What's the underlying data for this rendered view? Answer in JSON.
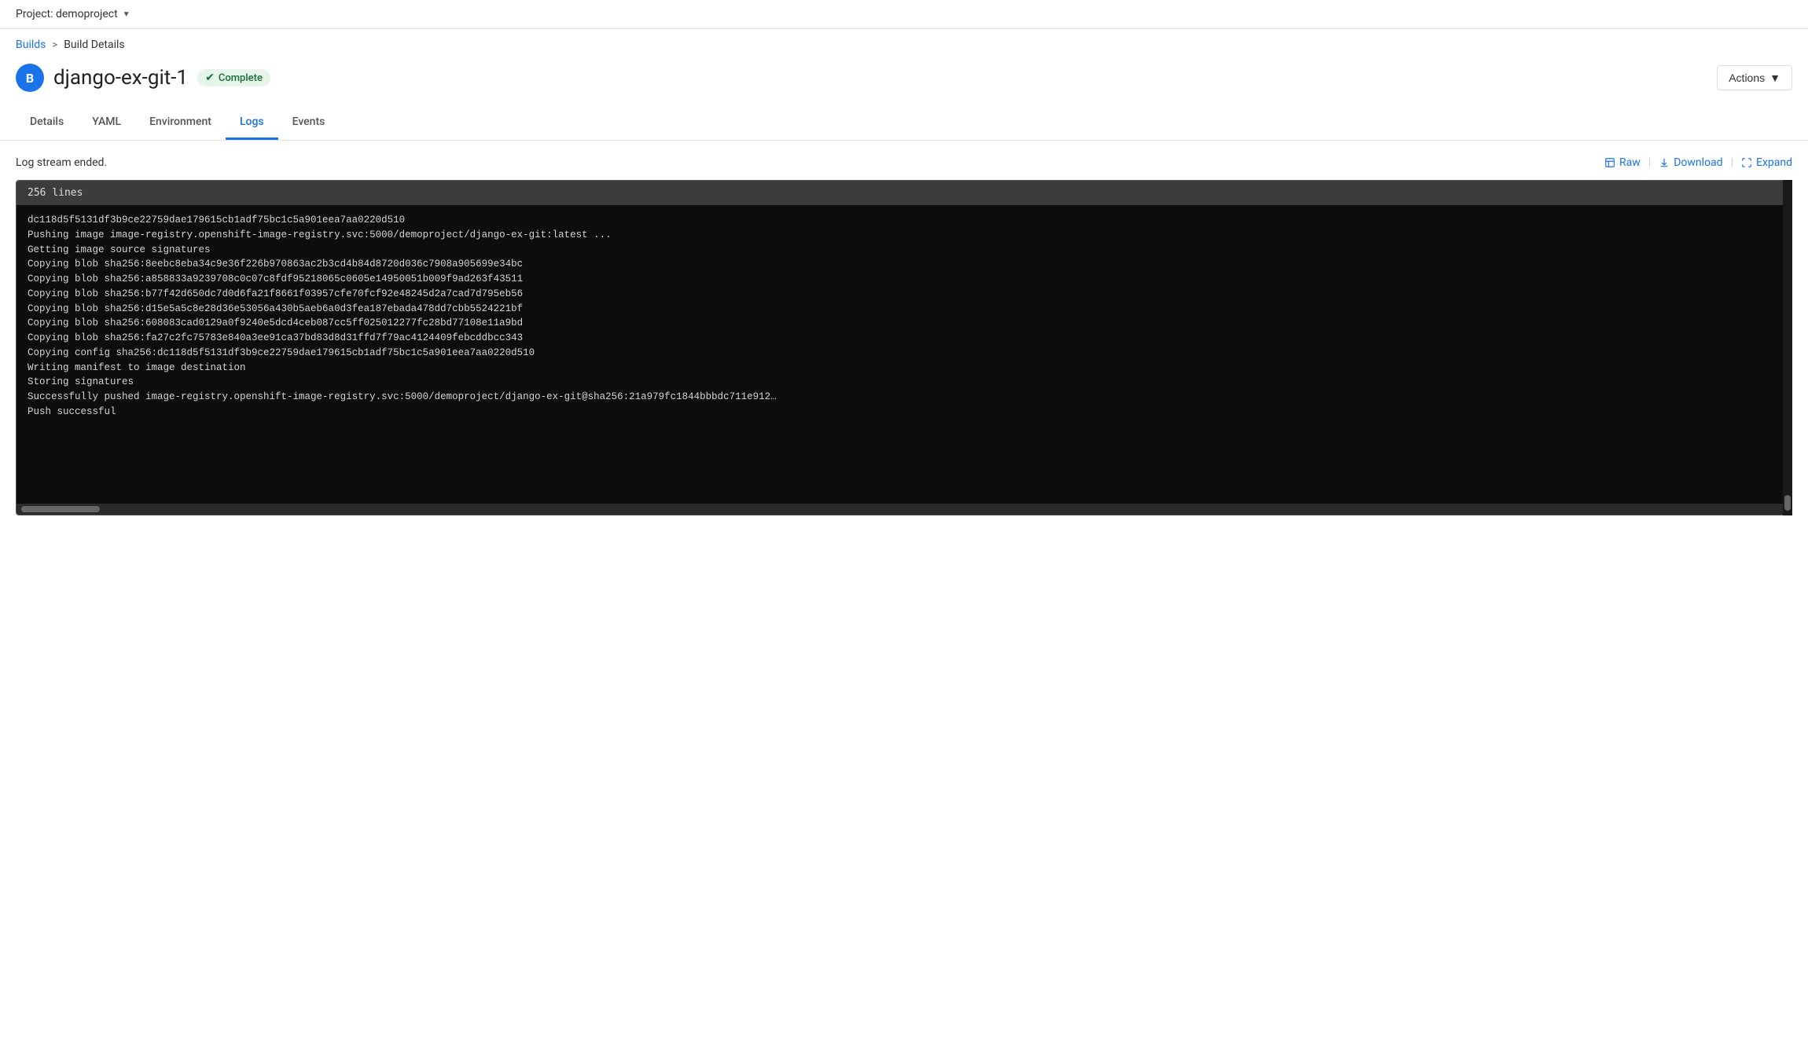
{
  "topbar": {
    "project_label": "Project: demoproject",
    "chevron": "▼"
  },
  "breadcrumb": {
    "builds_label": "Builds",
    "separator": ">",
    "current": "Build Details"
  },
  "header": {
    "build_icon_letter": "B",
    "build_name": "django-ex-git-1",
    "status_label": "Complete",
    "actions_label": "Actions",
    "actions_chevron": "▼"
  },
  "tabs": [
    {
      "id": "details",
      "label": "Details",
      "active": false
    },
    {
      "id": "yaml",
      "label": "YAML",
      "active": false
    },
    {
      "id": "environment",
      "label": "Environment",
      "active": false
    },
    {
      "id": "logs",
      "label": "Logs",
      "active": true
    },
    {
      "id": "events",
      "label": "Events",
      "active": false
    }
  ],
  "logs": {
    "status_text": "Log stream ended.",
    "lines_label": "256 lines",
    "raw_label": "Raw",
    "download_label": "Download",
    "expand_label": "Expand",
    "lines": [
      {
        "text": "dc118d5f5131df3b9ce22759dae179615cb1adf75bc1c5a901eea7aa0220d510",
        "faded": false
      },
      {
        "text": "",
        "faded": false
      },
      {
        "text": "Pushing image image-registry.openshift-image-registry.svc:5000/demoproject/django-ex-git:latest ...",
        "faded": false
      },
      {
        "text": "Getting image source signatures",
        "faded": false
      },
      {
        "text": "Copying blob sha256:8eebc8eba34c9e36f226b970863ac2b3cd4b84d8720d036c7908a905699e34bc",
        "faded": false
      },
      {
        "text": "Copying blob sha256:a858833a9239708c0c07c8fdf95218065c0605e14950051b009f9ad263f43511",
        "faded": false
      },
      {
        "text": "Copying blob sha256:b77f42d650dc7d0d6fa21f8661f03957cfe70fcf92e48245d2a7cad7d795eb56",
        "faded": false
      },
      {
        "text": "Copying blob sha256:d15e5a5c8e28d36e53056a430b5aeb6a0d3fea187ebada478dd7cbb5524221bf",
        "faded": false
      },
      {
        "text": "Copying blob sha256:608083cad0129a0f9240e5dcd4ceb087cc5ff025012277fc28bd77108e11a9bd",
        "faded": false
      },
      {
        "text": "Copying blob sha256:fa27c2fc75783e840a3ee91ca37bd83d8d31ffd7f79ac4124409febcddbcc343",
        "faded": false
      },
      {
        "text": "Copying config sha256:dc118d5f5131df3b9ce22759dae179615cb1adf75bc1c5a901eea7aa0220d510",
        "faded": false
      },
      {
        "text": "Writing manifest to image destination",
        "faded": false
      },
      {
        "text": "Storing signatures",
        "faded": false
      },
      {
        "text": "Successfully pushed image-registry.openshift-image-registry.svc:5000/demoproject/django-ex-git@sha256:21a979fc1844bbbdc711e912…",
        "faded": false
      },
      {
        "text": "Push successful",
        "faded": false
      }
    ]
  }
}
